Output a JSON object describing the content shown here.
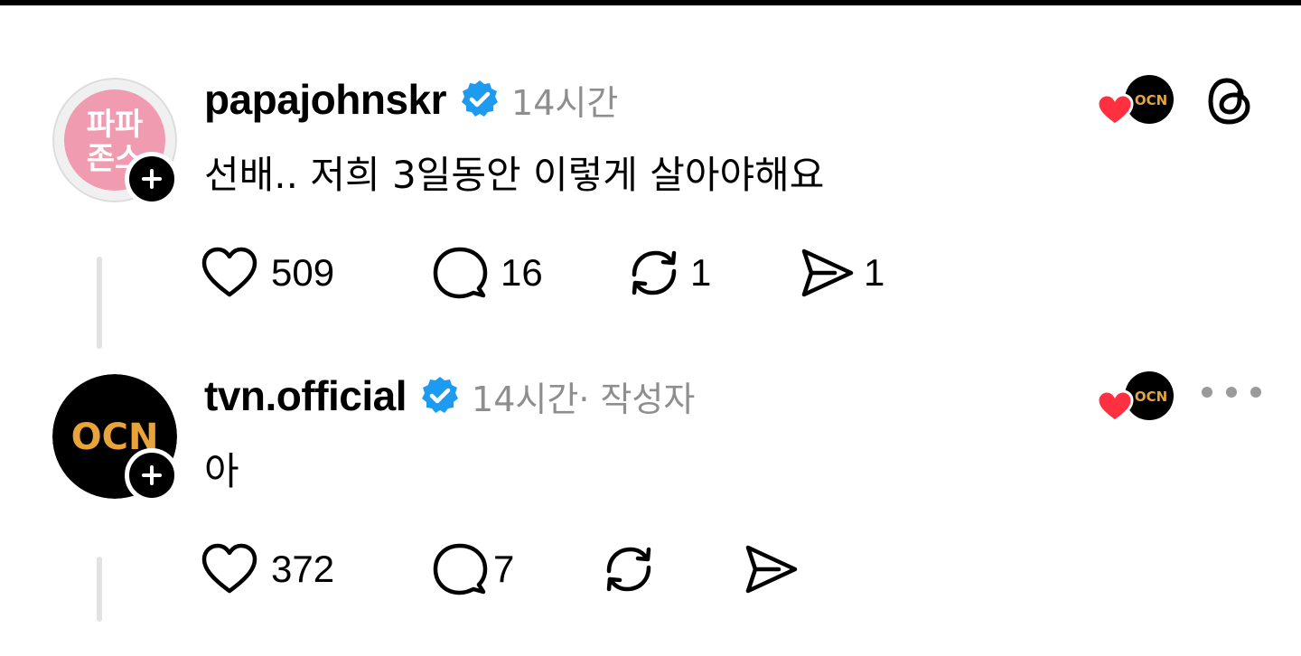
{
  "posts": [
    {
      "username": "papajohnskr",
      "time": "14시간",
      "author_tag": "",
      "text": "선배.. 저희 3일동안 이렇게 살아야해요",
      "avatar_text_line1": "파파",
      "avatar_text_line2": "존스",
      "likes": "509",
      "replies": "16",
      "reposts": "1",
      "shares": "1",
      "liker_logo_text": "OCN",
      "avatar_color": "#f19bb1"
    },
    {
      "username": "tvn.official",
      "time": "14시간",
      "author_tag": " · 작성자",
      "text": "아",
      "avatar_logo_text": "OCN",
      "likes": "372",
      "replies": "7",
      "reposts": "",
      "shares": "",
      "liker_logo_text": "OCN",
      "avatar_color": "#000000"
    }
  ],
  "colors": {
    "verified": "#1d9bf0",
    "heart": "#ff3040",
    "ocn_gold": "#e8a33a",
    "meta_gray": "#8e8e8e"
  },
  "icons": [
    "heart-icon",
    "comment-icon",
    "repost-icon",
    "share-icon",
    "verified-icon",
    "threads-logo-icon",
    "more-icon",
    "plus-icon"
  ]
}
